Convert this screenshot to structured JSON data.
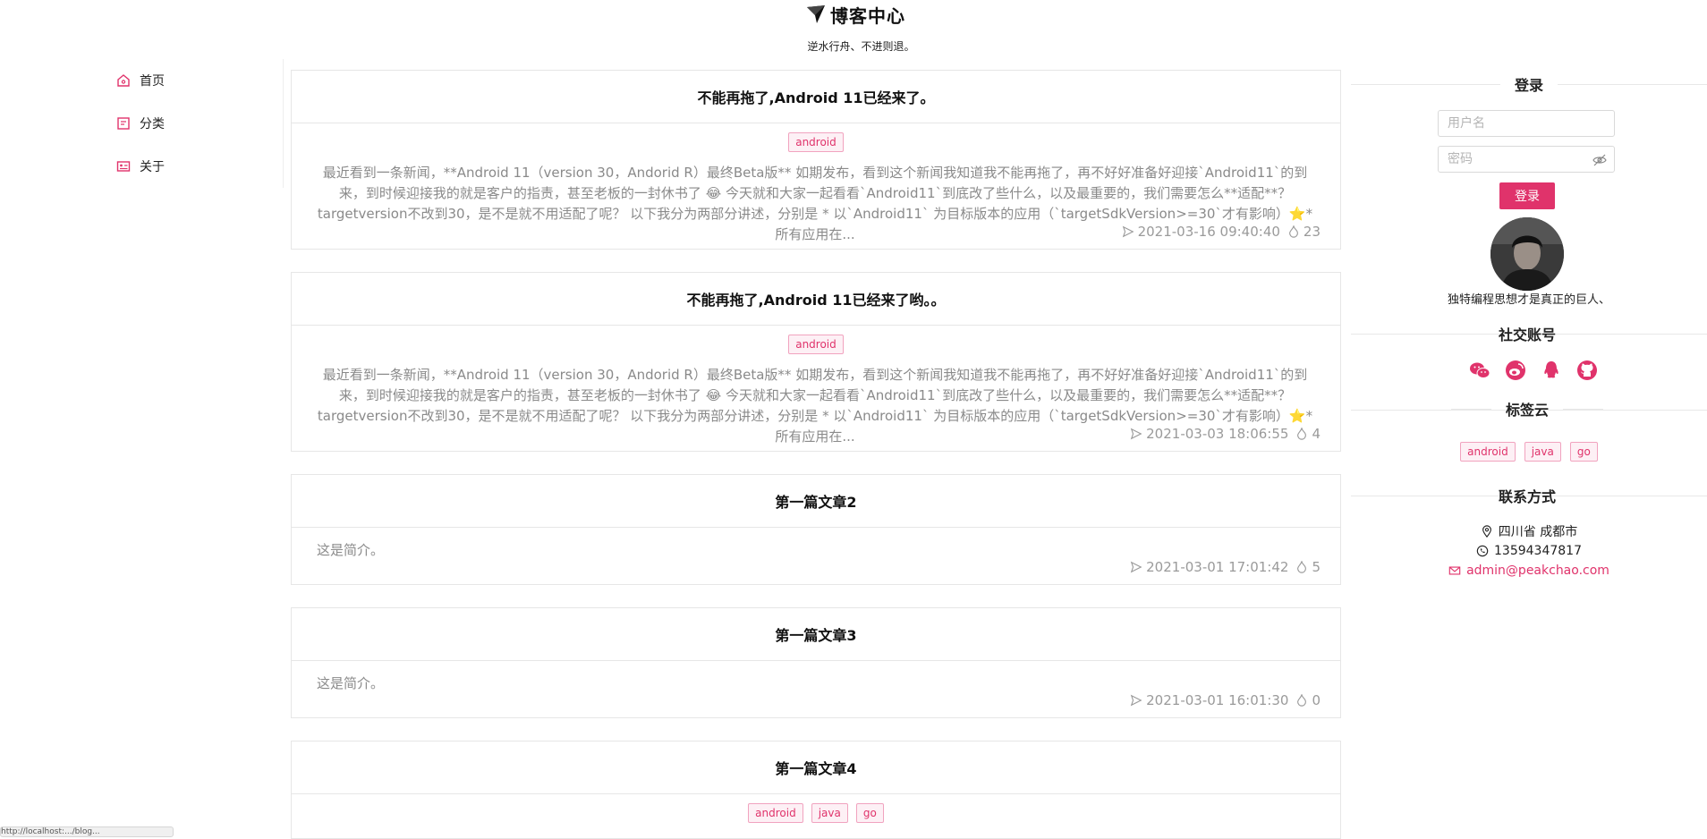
{
  "header": {
    "title": "博客中心",
    "subtitle": "逆水行舟、不进则退。",
    "logo_icon": "paper-plane-logo-icon"
  },
  "nav": {
    "items": [
      {
        "label": "首页",
        "icon": "home-icon"
      },
      {
        "label": "分类",
        "icon": "category-icon"
      },
      {
        "label": "关于",
        "icon": "profile-card-icon"
      }
    ]
  },
  "posts": [
    {
      "title": "不能再拖了,Android 11已经来了。",
      "tags": [
        "android"
      ],
      "excerpt": "最近看到一条新闻，**Android 11（version 30，Andorid R）最终Beta版** 如期发布，看到这个新闻我知道我不能再拖了，再不好好准备好迎接`Android11`的到来，到时候迎接我的就是客户的指责，甚至老板的一封休书了 😂   今天就和大家一起看看`Android11`到底改了些什么，以及最重要的，我们需要怎么**适配**？ targetversion不改到30，是不是就不用适配了呢？ 以下我分为两部分讲述，分别是 * 以`Android11` 为目标版本的应用（`targetSdkVersion>=30`才有影响）⭐* 所有应用在...",
      "date": "2021-03-16 09:40:40",
      "likes": "23"
    },
    {
      "title": "不能再拖了,Android 11已经来了哟。。",
      "tags": [
        "android"
      ],
      "excerpt": "最近看到一条新闻，**Android 11（version 30，Andorid R）最终Beta版** 如期发布，看到这个新闻我知道我不能再拖了，再不好好准备好迎接`Android11`的到来，到时候迎接我的就是客户的指责，甚至老板的一封休书了 😂   今天就和大家一起看看`Android11`到底改了些什么，以及最重要的，我们需要怎么**适配**？ targetversion不改到30，是不是就不用适配了呢？ 以下我分为两部分讲述，分别是 * 以`Android11` 为目标版本的应用（`targetSdkVersion>=30`才有影响）⭐* 所有应用在...",
      "date": "2021-03-03 18:06:55",
      "likes": "4"
    },
    {
      "title": "第一篇文章2",
      "tags": [],
      "excerpt": "这是简介。",
      "date": "2021-03-01 17:01:42",
      "likes": "5"
    },
    {
      "title": "第一篇文章3",
      "tags": [],
      "excerpt": "这是简介。",
      "date": "2021-03-01 16:01:30",
      "likes": "0"
    },
    {
      "title": "第一篇文章4",
      "tags": [
        "android",
        "java",
        "go"
      ],
      "excerpt": "",
      "date": "",
      "likes": ""
    }
  ],
  "sidebar": {
    "login": {
      "title": "登录",
      "username_placeholder": "用户名",
      "password_placeholder": "密码",
      "button": "登录"
    },
    "motto": "独特编程思想才是真正的巨人、",
    "social": {
      "title": "社交账号",
      "icons": [
        "wechat-icon",
        "weibo-icon",
        "qq-icon",
        "github-icon"
      ]
    },
    "tag_cloud": {
      "title": "标签云",
      "tags": [
        "android",
        "java",
        "go"
      ]
    },
    "contact": {
      "title": "联系方式",
      "location": "四川省 成都市",
      "phone": "13594347817",
      "email": "admin@peakchao.com"
    }
  },
  "status_bar": {
    "url": "http://localhost:.../blog..."
  },
  "colors": {
    "accent": "#e0336b",
    "tag_bg": "#fdf0f5",
    "muted_text": "#8a8a8a",
    "border": "#e6e6e6"
  }
}
